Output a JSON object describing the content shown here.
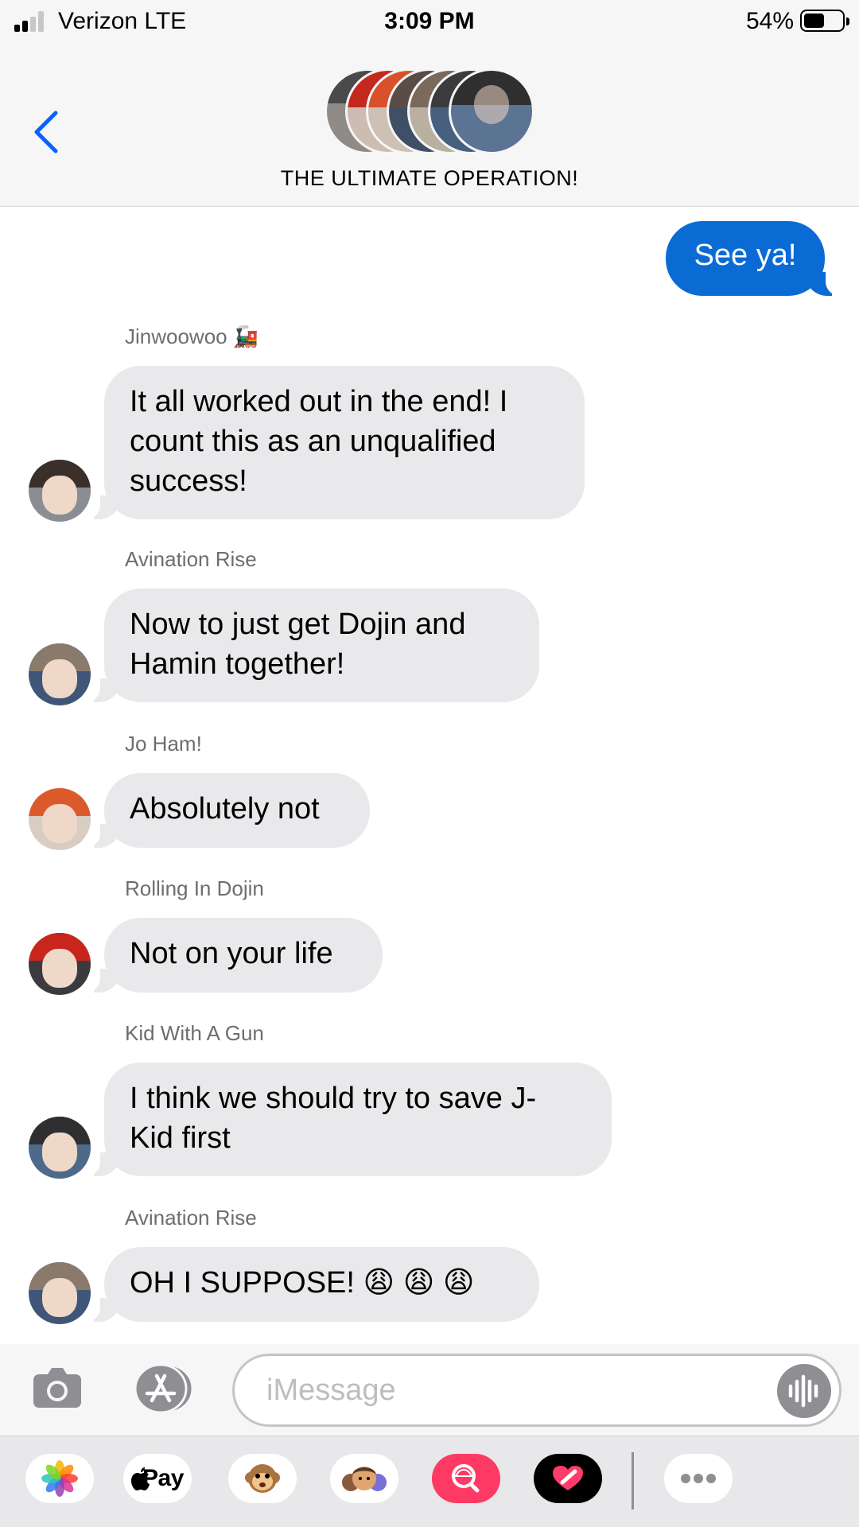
{
  "status_bar": {
    "carrier": "Verizon  LTE",
    "time": "3:09 PM",
    "battery_percent": "54%",
    "battery_level": 0.54,
    "signal_bars": 2
  },
  "header": {
    "group_name": "THE ULTIMATE OPERATION!",
    "back_icon": "chevron-left-icon"
  },
  "messages": [
    {
      "direction": "outgoing",
      "text": "See ya!"
    },
    {
      "direction": "incoming",
      "sender": "Jinwoowoo",
      "sender_emoji": "🚂",
      "lines": [
        "It all worked out in the end! I",
        "count this as an unqualified",
        "success!"
      ]
    },
    {
      "direction": "incoming",
      "sender": "Avination Rise",
      "lines": [
        "Now to just get Dojin and",
        "Hamin together!"
      ]
    },
    {
      "direction": "incoming",
      "sender": "Jo Ham!",
      "lines": [
        "Absolutely not"
      ]
    },
    {
      "direction": "incoming",
      "sender": "Rolling In Dojin",
      "lines": [
        "Not on your life"
      ]
    },
    {
      "direction": "incoming",
      "sender": "Kid With A Gun",
      "lines": [
        "I think we should try to save J-",
        "Kid first"
      ]
    },
    {
      "direction": "incoming",
      "sender": "Avination Rise",
      "lines": [
        "OH I SUPPOSE! 😩 😩 😩"
      ]
    }
  ],
  "input_bar": {
    "placeholder": "iMessage",
    "camera_icon": "camera-icon",
    "apps_icon": "app-store-icon",
    "voice_icon": "waveform-icon"
  },
  "app_drawer": {
    "items": [
      {
        "name": "photos-app-icon"
      },
      {
        "name": "apple-pay-app",
        "label": "Pay"
      },
      {
        "name": "animoji-monkey-icon"
      },
      {
        "name": "memoji-icon"
      },
      {
        "name": "image-search-icon"
      },
      {
        "name": "digital-touch-heart-icon"
      },
      {
        "name": "more-apps-icon"
      }
    ]
  },
  "colors": {
    "outgoing_bubble": "#0b6bd5",
    "incoming_bubble": "#e9e9eb",
    "accent": "#0a60ff",
    "search_app": "#fe3a64"
  }
}
